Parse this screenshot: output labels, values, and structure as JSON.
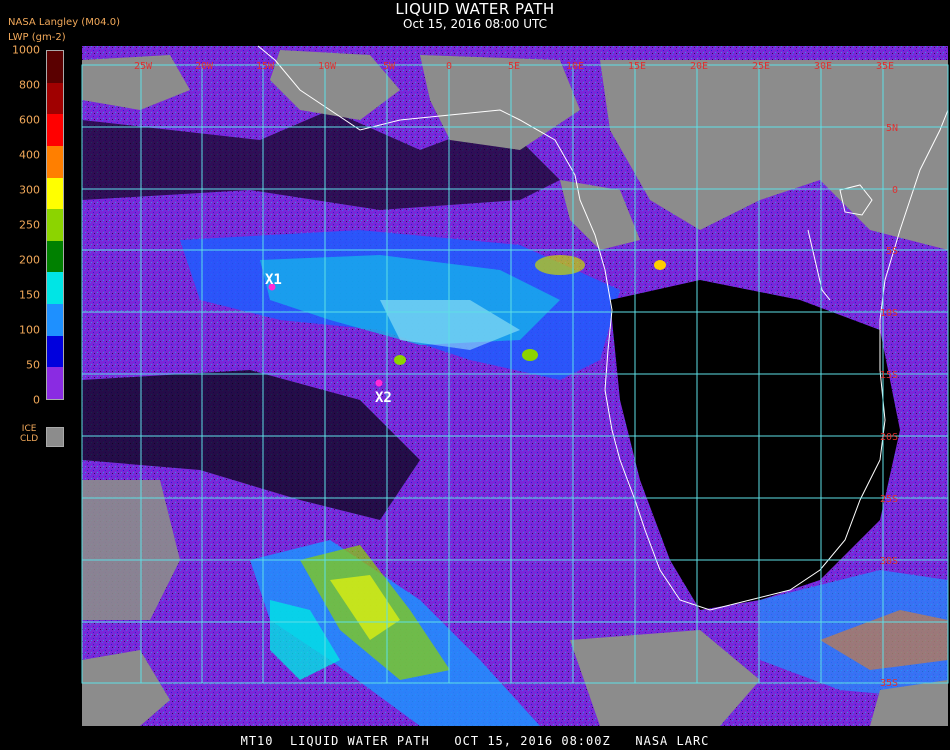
{
  "header": {
    "title": "LIQUID WATER PATH",
    "subtitle": "Oct 15, 2016 08:00 UTC",
    "source": "NASA Langley (M04.0)",
    "unit": "LWP (gm-2)"
  },
  "legend": {
    "ticks": [
      "1000",
      "800",
      "600",
      "400",
      "300",
      "250",
      "200",
      "150",
      "100",
      "50",
      "0"
    ],
    "colors": [
      "#5a0000",
      "#a00000",
      "#ff0000",
      "#ff7f00",
      "#ffff00",
      "#8cd400",
      "#008000",
      "#00e5e5",
      "#1e90ff",
      "#0000dd",
      "#8a2be2"
    ],
    "ice_label_1": "ICE",
    "ice_label_2": "CLD",
    "ice_color": "#8c8c8c"
  },
  "map": {
    "lon_labels": [
      "25W",
      "20W",
      "15W",
      "10W",
      "5W",
      "0",
      "5E",
      "10E",
      "15E",
      "20E",
      "25E",
      "30E",
      "35E"
    ],
    "lat_labels": [
      "5N",
      "0",
      "5S",
      "10S",
      "15S",
      "20S",
      "25S",
      "30S",
      "35S"
    ],
    "markers": [
      {
        "label": "X1",
        "color": "#ff2bd6"
      },
      {
        "label": "X2",
        "color": "#ff2bd6"
      }
    ],
    "grid_color": "#5ee0e6",
    "coast_color": "#ffffff",
    "label_color": "#e03030"
  },
  "footer": {
    "text": "MT10  LIQUID WATER PATH   OCT 15, 2016 08:00Z   NASA LARC"
  }
}
